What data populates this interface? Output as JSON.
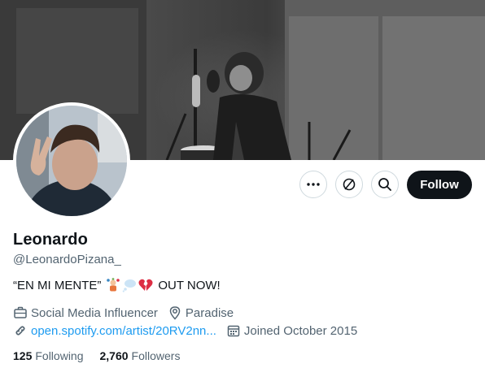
{
  "profile": {
    "display_name": "Leonardo",
    "handle": "@LeonardoPizana_",
    "bio_before": "“EN MI MENTE”",
    "bio_after": "OUT NOW!",
    "bio_emojis": [
      "man-juggling-emoji",
      "thought-balloon-emoji",
      "broken-heart-emoji"
    ]
  },
  "meta": {
    "category": "Social Media Influencer",
    "location": "Paradise",
    "link": "open.spotify.com/artist/20RV2nn...",
    "joined": "Joined October 2015"
  },
  "stats": {
    "following_count": "125",
    "following_label": "Following",
    "followers_count": "2,760",
    "followers_label": "Followers"
  },
  "actions": {
    "follow_label": "Follow"
  },
  "icons": [
    "more-icon",
    "subscribe-icon",
    "search-icon",
    "briefcase-icon",
    "location-icon",
    "link-icon",
    "calendar-icon"
  ],
  "colors": {
    "primary_text": "#0f1419",
    "secondary_text": "#536471",
    "link": "#1d9bf0",
    "follow_bg": "#0f1419"
  }
}
